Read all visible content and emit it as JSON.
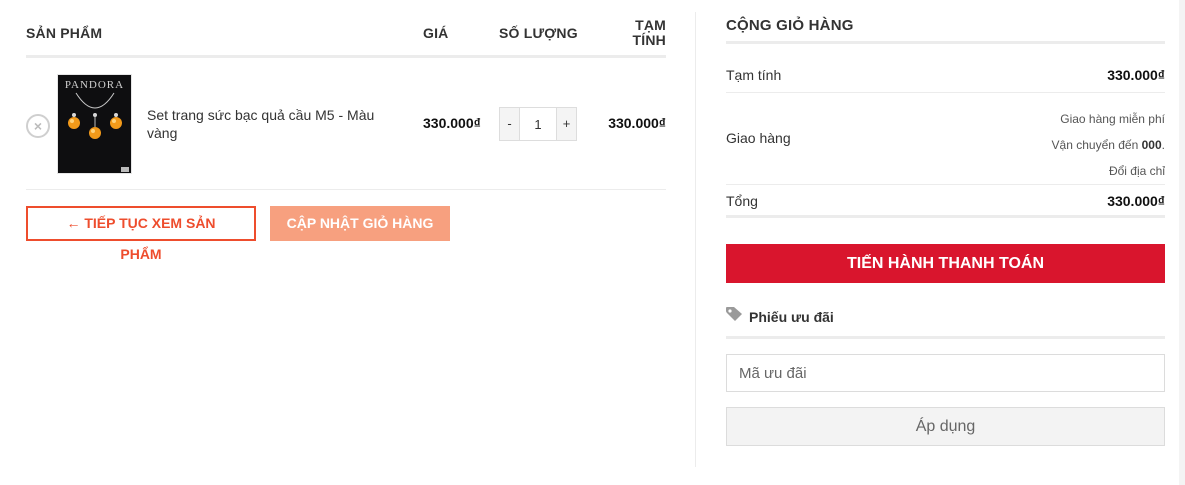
{
  "cart": {
    "headers": {
      "product": "SẢN PHẨM",
      "price": "GIÁ",
      "quantity": "SỐ LƯỢNG",
      "subtotal_line1": "TẠM",
      "subtotal_line2": "TÍNH"
    },
    "items": [
      {
        "remove_icon": "×",
        "image_brand": "PANDORA",
        "name": "Set trang sức bạc quả cầu M5 - Màu vàng",
        "price": "330.000₫",
        "qty_minus": "-",
        "quantity": "1",
        "qty_plus": "+",
        "subtotal": "330.000₫"
      }
    ],
    "continue_label": "← TIẾP TỤC XEM SẢN PHẨM",
    "update_label": "CẬP NHẬT GIỎ HÀNG"
  },
  "totals": {
    "title": "CỘNG GIỎ HÀNG",
    "subtotal_label": "Tạm tính",
    "subtotal_value": "330.000₫",
    "shipping_label": "Giao hàng",
    "shipping_option": "Giao hàng miễn phí",
    "shipping_dest_prefix": "Vận chuyển đến",
    "shipping_dest_value": "000",
    "shipping_dest_suffix": ".",
    "change_address": "Đổi địa chỉ",
    "total_label": "Tổng",
    "total_value": "330.000₫",
    "checkout_label": "TIẾN HÀNH THANH TOÁN"
  },
  "coupon": {
    "icon": "tag-icon",
    "title": "Phiếu ưu đãi",
    "placeholder": "Mã ưu đãi",
    "apply_label": "Áp dụng"
  },
  "colors": {
    "accent_orange": "#ee4d2d",
    "update_button": "#f7a07f",
    "checkout_red": "#d9152d"
  }
}
